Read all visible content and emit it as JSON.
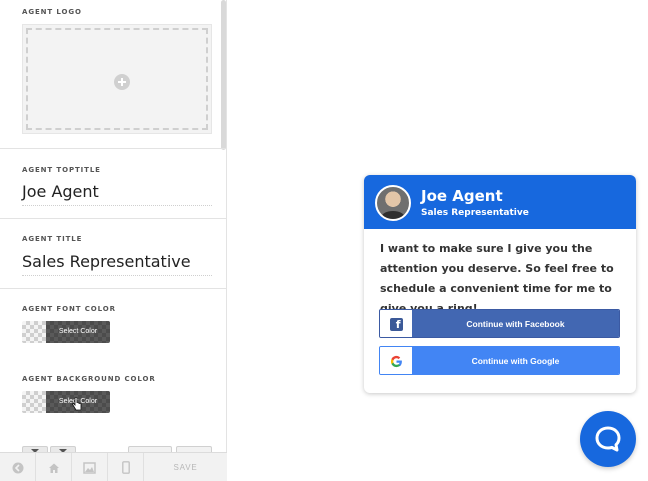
{
  "panel": {
    "logo_label": "AGENT LOGO",
    "toptitle_label": "AGENT TOPTITLE",
    "toptitle_value": "Joe Agent",
    "title_label": "AGENT TITLE",
    "title_value": "Sales Representative",
    "font_color_label": "AGENT FONT COLOR",
    "font_color_button": "Select Color",
    "bg_color_label": "AGENT BACKGROUND COLOR",
    "bg_color_button": "Select Color",
    "save_label": "SAVE"
  },
  "widget": {
    "agent_name": "Joe Agent",
    "agent_title": "Sales Representative",
    "message": "I want to make sure I give you the attention you deserve. So feel free to schedule a convenient time for me to give you a ring!",
    "facebook_label": "Continue with Facebook",
    "google_label": "Continue with Google",
    "header_color": "#1768de"
  },
  "icons": {
    "back": "back-icon",
    "home": "home-icon",
    "image": "image-icon",
    "mobile": "mobile-icon",
    "chat": "chat-icon"
  }
}
